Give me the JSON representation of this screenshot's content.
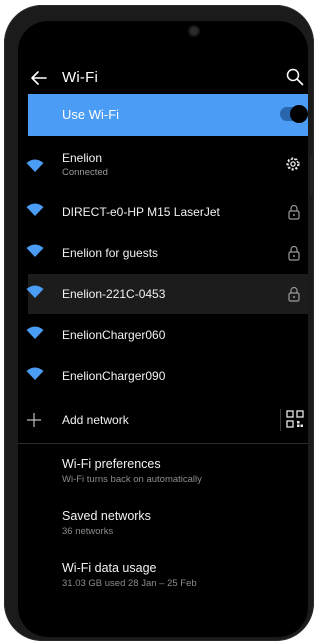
{
  "header": {
    "title": "Wi-Fi"
  },
  "use_wifi": {
    "label": "Use Wi-Fi",
    "enabled": true,
    "accent_color": "#4a9cf5"
  },
  "networks": [
    {
      "name": "Enelion",
      "status": "Connected",
      "icon": "wifi-icon",
      "right_icon": "gear-icon"
    },
    {
      "name": "DIRECT-e0-HP M15 LaserJet",
      "status": "",
      "icon": "wifi-icon",
      "right_icon": "lock-icon"
    },
    {
      "name": "Enelion for guests",
      "status": "",
      "icon": "wifi-icon",
      "right_icon": "lock-icon"
    },
    {
      "name": "Enelion-221C-0453",
      "status": "",
      "icon": "wifi-icon",
      "right_icon": "lock-icon",
      "selected": true
    },
    {
      "name": "EnelionCharger060",
      "status": "",
      "icon": "wifi-icon",
      "right_icon": ""
    },
    {
      "name": "EnelionCharger090",
      "status": "",
      "icon": "wifi-icon",
      "right_icon": ""
    }
  ],
  "add_network": {
    "label": "Add network",
    "icon": "plus-icon",
    "right_icon": "qr-code-icon"
  },
  "preferences": [
    {
      "title": "Wi-Fi preferences",
      "subtitle": "Wi-Fi turns back on automatically"
    },
    {
      "title": "Saved networks",
      "subtitle": "36 networks"
    },
    {
      "title": "Wi-Fi data usage",
      "subtitle": "31.03 GB used 28 Jan – 25 Feb"
    }
  ]
}
